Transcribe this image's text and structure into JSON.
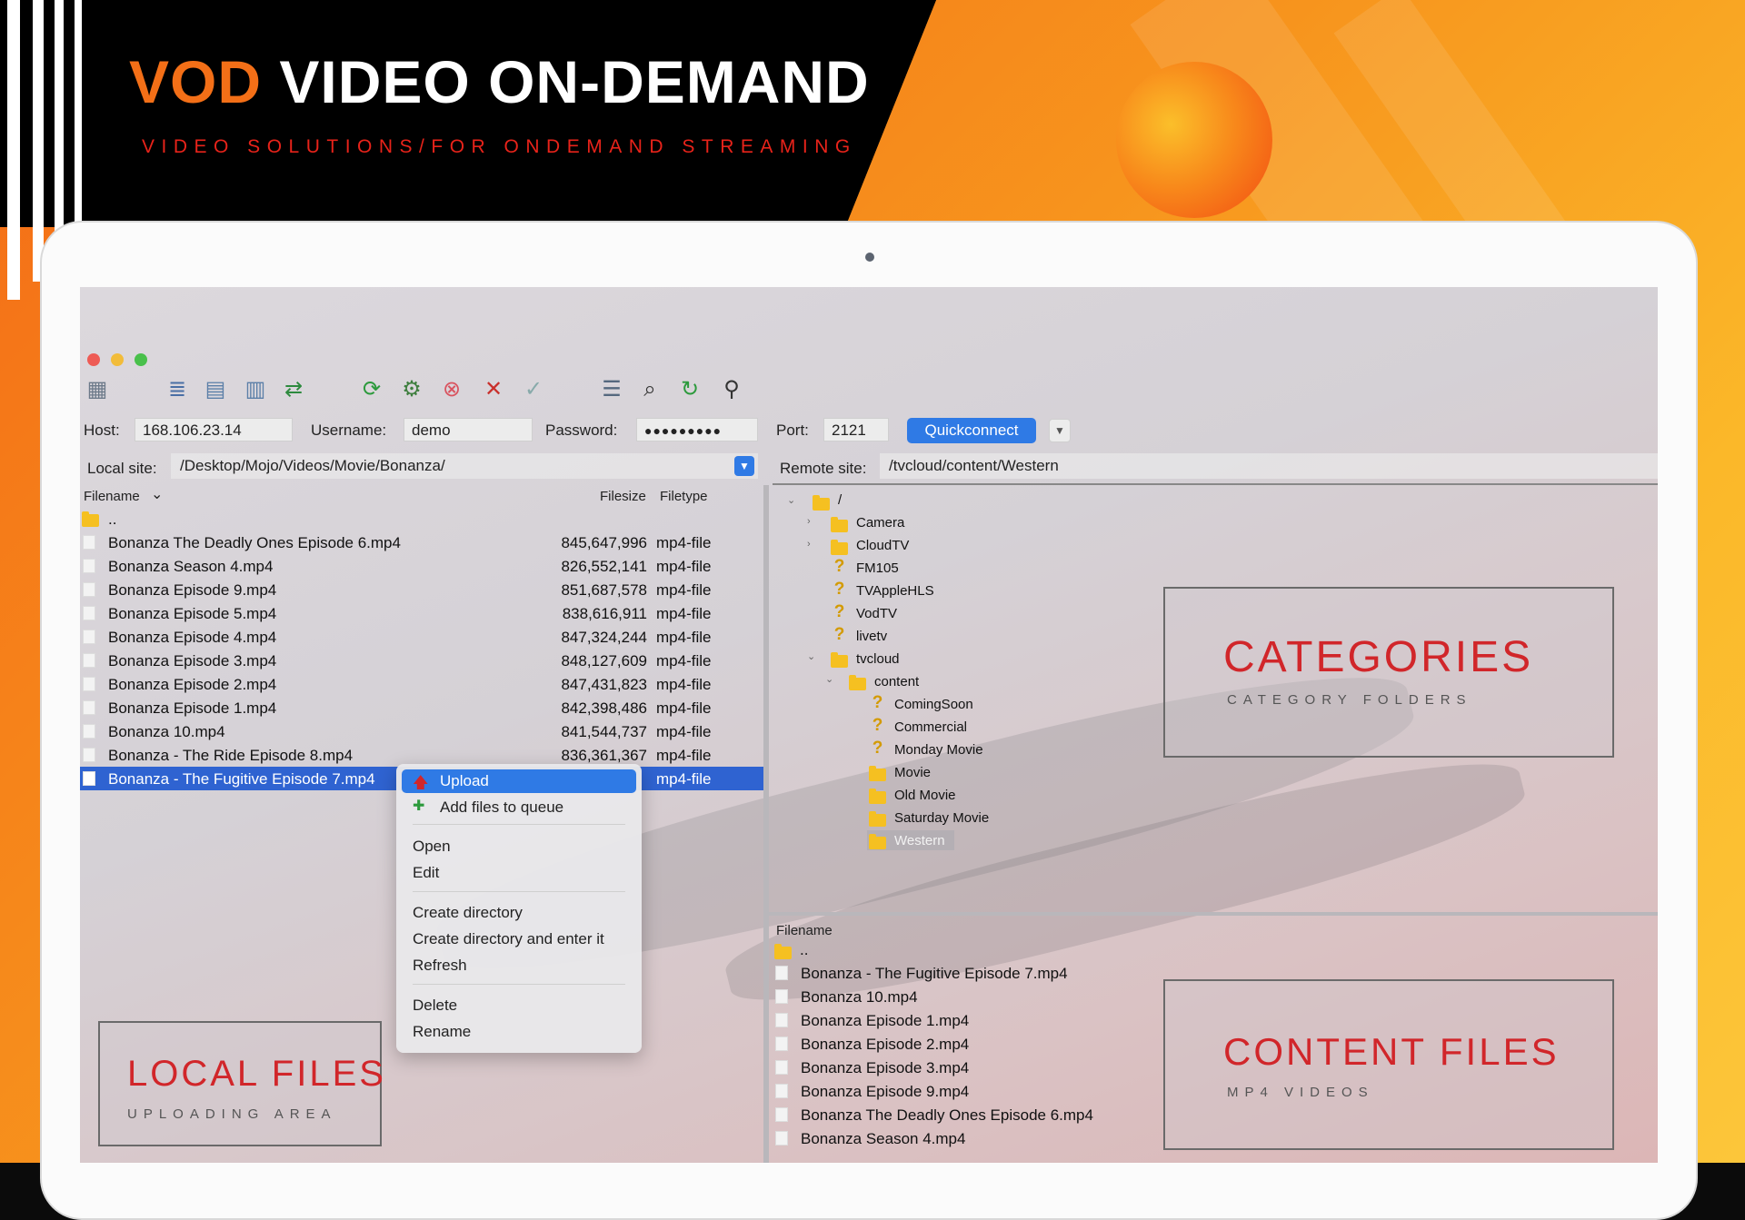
{
  "banner": {
    "title_accent": "VOD",
    "title_rest": "VIDEO ON-DEMAND",
    "subtitle": "VIDEO SOLUTIONS/FOR ONDEMAND STREAMING"
  },
  "colors": {
    "accent_orange": "#f36f17",
    "subtitle_red": "#e8231a",
    "quickconnect_blue": "#2f7ae5",
    "selection_blue": "#2f63d1",
    "callout_red": "#d1262a"
  },
  "toolbar": {
    "icons": [
      "site-manager-icon",
      "toggle-log-icon",
      "toggle-local-tree-icon",
      "toggle-remote-tree-icon",
      "transfer-queue-icon",
      "refresh-icon",
      "process-queue-icon",
      "cancel-icon",
      "disconnect-icon",
      "reconnect-icon",
      "directory-listing-filter-icon",
      "compare-icon",
      "sync-browse-icon",
      "search-icon"
    ]
  },
  "connection": {
    "host_label": "Host:",
    "host_value": "168.106.23.14",
    "username_label": "Username:",
    "username_value": "demo",
    "password_label": "Password:",
    "password_value": "●●●●●●●●●",
    "port_label": "Port:",
    "port_value": "2121",
    "quickconnect_label": "Quickconnect"
  },
  "local": {
    "site_label": "Local site:",
    "site_path": "/Desktop/Mojo/Videos/Movie/Bonanza/",
    "columns": {
      "filename": "Filename",
      "filesize": "Filesize",
      "filetype": "Filetype"
    },
    "parent": "..",
    "files": [
      {
        "name": "Bonanza The Deadly Ones  Episode 6.mp4",
        "size": "845,647,996",
        "type": "mp4-file"
      },
      {
        "name": "Bonanza Season 4.mp4",
        "size": "826,552,141",
        "type": "mp4-file"
      },
      {
        "name": "Bonanza Episode 9.mp4",
        "size": "851,687,578",
        "type": "mp4-file"
      },
      {
        "name": "Bonanza Episode 5.mp4",
        "size": "838,616,911",
        "type": "mp4-file"
      },
      {
        "name": "Bonanza Episode 4.mp4",
        "size": "847,324,244",
        "type": "mp4-file"
      },
      {
        "name": "Bonanza Episode 3.mp4",
        "size": "848,127,609",
        "type": "mp4-file"
      },
      {
        "name": "Bonanza Episode 2.mp4",
        "size": "847,431,823",
        "type": "mp4-file"
      },
      {
        "name": "Bonanza Episode 1.mp4",
        "size": "842,398,486",
        "type": "mp4-file"
      },
      {
        "name": "Bonanza 10.mp4",
        "size": "841,544,737",
        "type": "mp4-file"
      },
      {
        "name": "Bonanza - The Ride  Episode 8.mp4",
        "size": "836,361,367",
        "type": "mp4-file"
      },
      {
        "name": "Bonanza - The Fugitive  Episode 7.mp4",
        "size": "",
        "type": "mp4-file"
      }
    ]
  },
  "context_menu": {
    "upload": "Upload",
    "add_to_queue": "Add files to queue",
    "open": "Open",
    "edit": "Edit",
    "create_directory": "Create directory",
    "create_directory_enter": "Create directory and enter it",
    "refresh": "Refresh",
    "delete": "Delete",
    "rename": "Rename"
  },
  "remote": {
    "site_label": "Remote site:",
    "site_path": "/tvcloud/content/Western",
    "tree": {
      "root": "/",
      "camera": "Camera",
      "cloudtv": "CloudTV",
      "fm105": "FM105",
      "tvapplehls": "TVAppleHLS",
      "vodtv": "VodTV",
      "livetv": "livetv",
      "tvcloud": "tvcloud",
      "content": "content",
      "comingsoon": "ComingSoon",
      "commercial": "Commercial",
      "monday_movie": "Monday Movie",
      "movie": "Movie",
      "old_movie": "Old Movie",
      "saturday_movie": "Saturday Movie",
      "western": "Western"
    },
    "columns": {
      "filename": "Filename"
    },
    "parent": "..",
    "files": [
      "Bonanza - The Fugitive  Episode 7.mp4",
      "Bonanza 10.mp4",
      "Bonanza Episode 1.mp4",
      "Bonanza Episode 2.mp4",
      "Bonanza Episode 3.mp4",
      "Bonanza Episode 9.mp4",
      "Bonanza The Deadly Ones  Episode 6.mp4",
      "Bonanza Season 4.mp4"
    ]
  },
  "callouts": {
    "categories_title": "CATEGORIES",
    "categories_sub": "CATEGORY FOLDERS",
    "content_title": "CONTENT FILES",
    "content_sub": "MP4 VIDEOS",
    "local_title": "LOCAL FILES",
    "local_sub": "UPLOADING AREA"
  }
}
